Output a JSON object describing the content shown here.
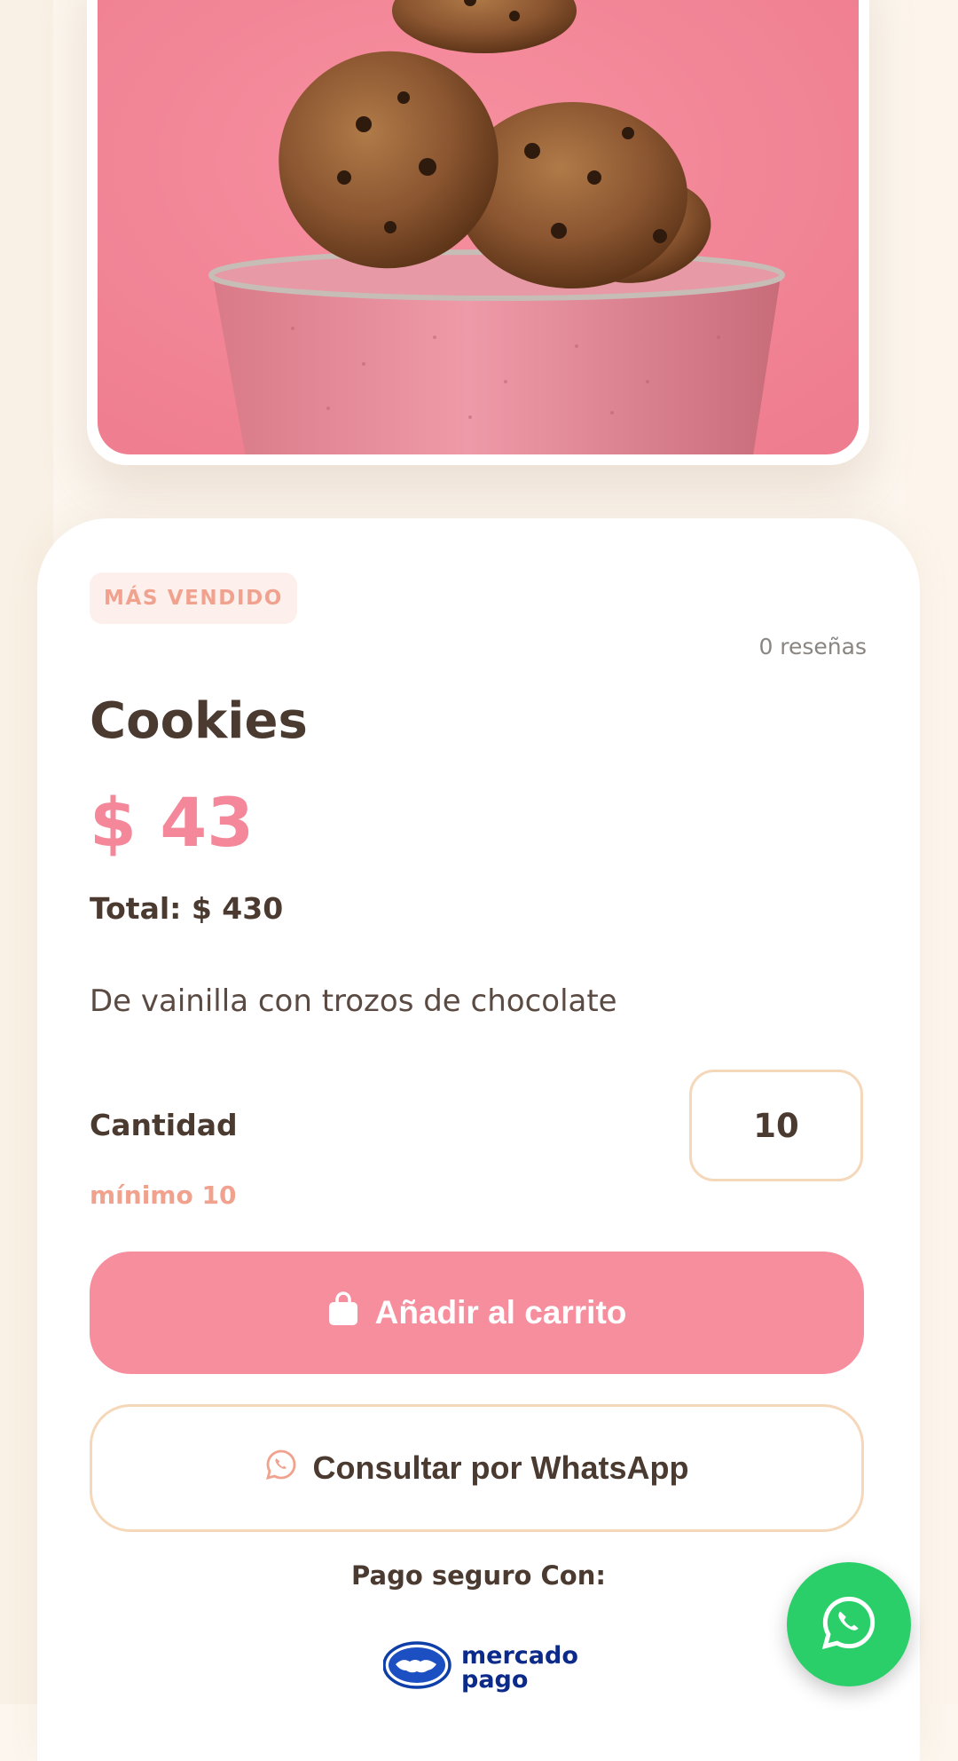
{
  "product": {
    "image_icon": "cookies-in-pink-bowl-photo",
    "badge": "MÁS VENDIDO",
    "reviews": "0 reseñas",
    "title": "Cookies",
    "price": "$ 43",
    "total": "Total: $ 430",
    "description": "De vainilla con trozos de chocolate"
  },
  "quantity": {
    "label": "Cantidad",
    "value": "10",
    "min_note": "mínimo 10"
  },
  "actions": {
    "add_to_cart_label": "Añadir al carrito",
    "add_to_cart_icon": "shopping-bag-icon",
    "whatsapp_label": "Consultar por WhatsApp",
    "whatsapp_icon": "whatsapp-icon"
  },
  "payment": {
    "label": "Pago seguro Con:",
    "logo_line1": "mercado",
    "logo_line2": "pago",
    "logo_icon": "handshake-icon"
  },
  "fab": {
    "icon": "whatsapp-icon"
  },
  "colors": {
    "accent_pink": "#f78e9e",
    "badge_text": "#f1a28e",
    "outline_beige": "#f5d7b9",
    "whatsapp_green": "#2bcf6a",
    "page_bg": "#fcf6ee",
    "text_dark": "#4b3a30"
  }
}
